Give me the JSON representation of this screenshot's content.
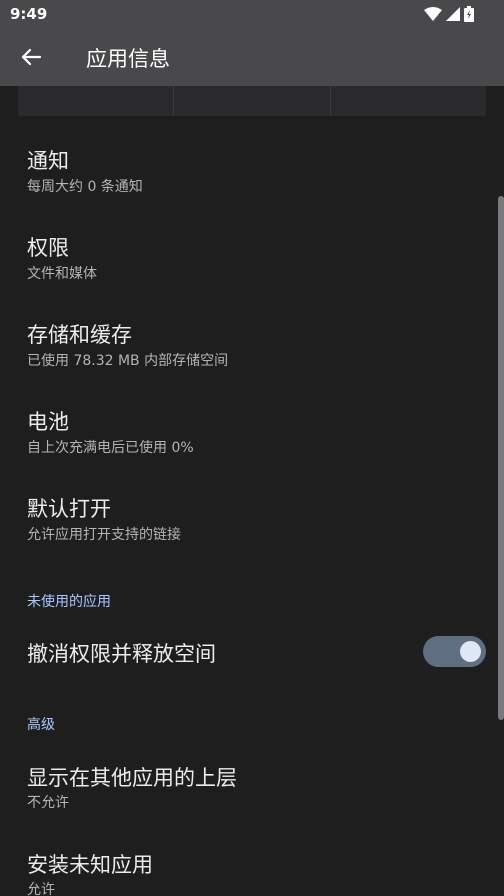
{
  "status": {
    "time": "9:49"
  },
  "appbar": {
    "title": "应用信息"
  },
  "settings": {
    "notifications": {
      "title": "通知",
      "subtitle": "每周大约 0 条通知"
    },
    "permissions": {
      "title": "权限",
      "subtitle": "文件和媒体"
    },
    "storage": {
      "title": "存储和缓存",
      "subtitle": "已使用 78.32 MB 内部存储空间"
    },
    "battery": {
      "title": "电池",
      "subtitle": "自上次充满电后已使用 0%"
    },
    "open_by_default": {
      "title": "默认打开",
      "subtitle": "允许应用打开支持的链接"
    }
  },
  "unused_apps": {
    "header": "未使用的应用",
    "revoke": {
      "title": "撤消权限并释放空间",
      "enabled": true
    }
  },
  "advanced": {
    "header": "高级",
    "display_over": {
      "title": "显示在其他应用的上层",
      "subtitle": "不允许"
    },
    "install_unknown": {
      "title": "安装未知应用",
      "subtitle": "允许"
    }
  },
  "colors": {
    "background": "#1e1e1f",
    "appbar": "#49494b",
    "accent": "#a9c7ff",
    "toggle_track": "#5f6e80"
  }
}
